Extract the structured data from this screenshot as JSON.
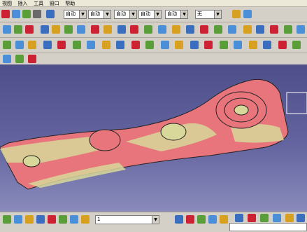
{
  "menu": {
    "items": [
      "视图",
      "插入",
      "工具",
      "窗口",
      "帮助"
    ]
  },
  "toolbar1": {
    "combos": [
      {
        "value": "自动"
      },
      {
        "value": "自动"
      },
      {
        "value": "自动"
      },
      {
        "value": "自动"
      },
      {
        "value": "自动"
      },
      {
        "value": "无"
      }
    ]
  },
  "bottombar": {
    "layer_value": "1"
  },
  "colors": {
    "part_pink": "#e8747c",
    "part_yellow": "#d8d89a",
    "viewport_top": "#4e4f8a",
    "viewport_bottom": "#8a8bbb"
  }
}
